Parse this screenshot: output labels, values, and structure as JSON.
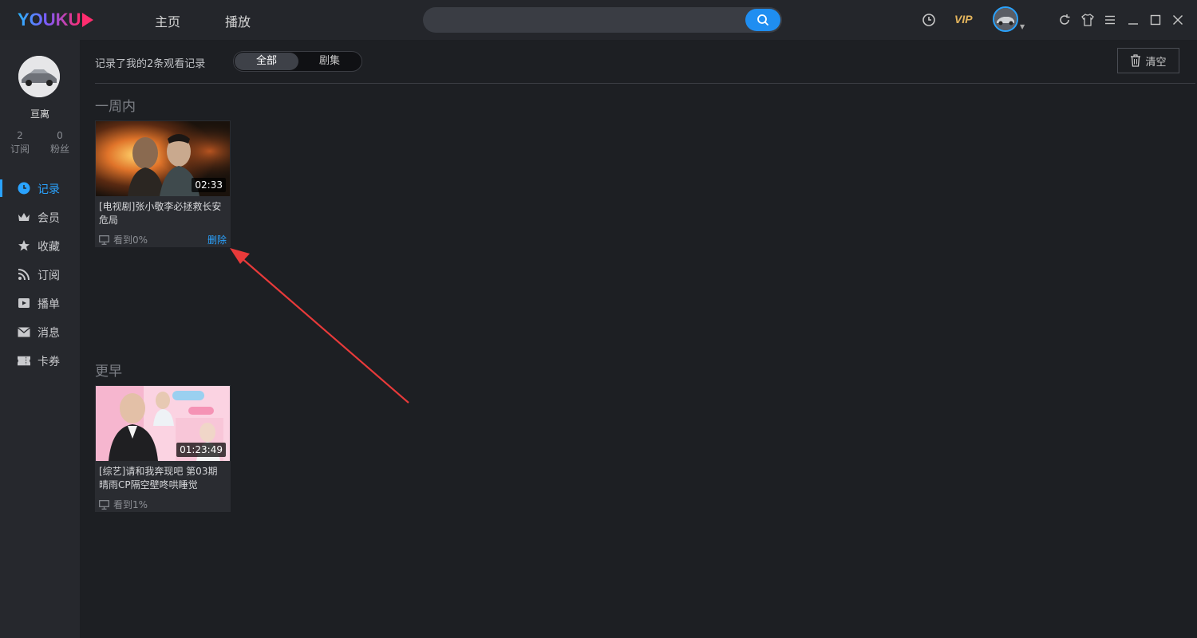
{
  "topbar": {
    "logo": "YOUKU",
    "nav": [
      "主页",
      "播放"
    ],
    "search": {
      "value": "",
      "placeholder": ""
    },
    "vip_label": "VIP"
  },
  "sidebar": {
    "username": "亘离",
    "stats": [
      {
        "value": "2",
        "label": "订阅"
      },
      {
        "value": "0",
        "label": "粉丝"
      }
    ],
    "menu": [
      {
        "label": "记录",
        "icon": "clock-icon",
        "active": true
      },
      {
        "label": "会员",
        "icon": "crown-icon"
      },
      {
        "label": "收藏",
        "icon": "star-icon"
      },
      {
        "label": "订阅",
        "icon": "rss-icon"
      },
      {
        "label": "播单",
        "icon": "playlist-icon"
      },
      {
        "label": "消息",
        "icon": "mail-icon"
      },
      {
        "label": "卡券",
        "icon": "ticket-icon"
      }
    ]
  },
  "main": {
    "record_count": "记录了我的2条观看记录",
    "filter_tabs": [
      "全部",
      "剧集"
    ],
    "clear_label": "清空",
    "sections": [
      {
        "title": "一周内",
        "items": [
          {
            "title": "[电视剧]张小敬李必拯救长安危局",
            "duration": "02:33",
            "progress": "看到0%",
            "delete_label": "删除"
          }
        ]
      },
      {
        "title": "更早",
        "items": [
          {
            "title": "[综艺]请和我奔现吧 第03期晴雨CP隔空壁咚哄睡觉",
            "duration": "01:23:49",
            "progress": "看到1%"
          }
        ]
      }
    ]
  },
  "colors": {
    "accent": "#2aa3ff",
    "vip_gold": "#e3b45c",
    "annotation_arrow": "#e83a3a"
  }
}
